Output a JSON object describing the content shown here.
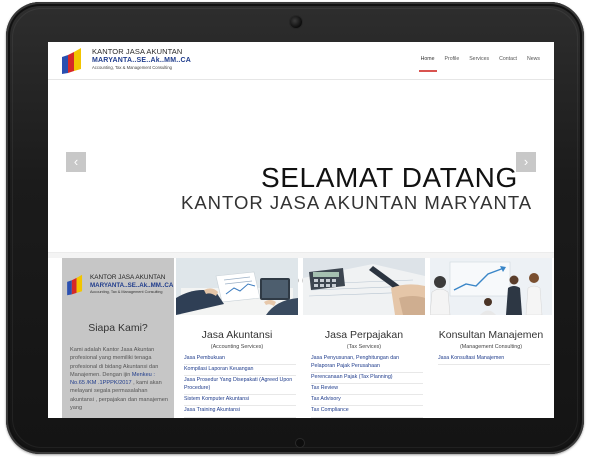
{
  "header": {
    "logo": {
      "line1": "KANTOR JASA AKUNTAN",
      "line2": "MARYANTA..SE..Ak..MM..CA",
      "line3": "Accounting, Tax & Management Consulting"
    },
    "nav": [
      {
        "label": "Home",
        "active": true
      },
      {
        "label": "Profile",
        "active": false
      },
      {
        "label": "Services",
        "active": false
      },
      {
        "label": "Contact",
        "active": false
      },
      {
        "label": "News",
        "active": false
      }
    ]
  },
  "slider": {
    "title": "SELAMAT DATANG",
    "subtitle": "KANTOR JASA AKUNTAN MARYANTA",
    "prev_icon": "chevron-left-icon",
    "next_icon": "chevron-right-icon",
    "prev_glyph": "‹",
    "next_glyph": "›"
  },
  "about": {
    "logo": {
      "line1": "KANTOR JASA AKUNTAN",
      "line2": "MARYANTA..SE..Ak..MM..CA",
      "line3": "Accounting, Tax & Management Consulting"
    },
    "title": "Siapa Kami?",
    "body_part1": "Kami adalah Kantor Jasa Akuntan profesional yang memiliki tenaga profesional di bidang Akuntansi dan Manajemen. Dengan ijin ",
    "body_highlight": "Menkeu : No.65 /KM .1PPPK/2017",
    "body_part2": " , kami akan melayani segala permasalahan akuntansi , perpajakan dan manajemen yang"
  },
  "services": [
    {
      "title": "Jasa Akuntansi",
      "subtitle": "(Accounting Services)",
      "items": [
        "Jasa Pembukuan",
        "Kompilasi Laporan Keuangan",
        "Jasa Prosedur Yang Disepakati (Agreed Upon Procedure)",
        "Sistem Komputer Akuntansi",
        "Jasa Training Akuntansi"
      ]
    },
    {
      "title": "Jasa Perpajakan",
      "subtitle": "(Tax Services)",
      "items": [
        "Jasa Penyusunan, Penghitungan dan Pelaporan Pajak Perusahaan",
        "Perencanaan Pajak (Tax Planning)",
        "Tax Review",
        "Tax Advisory",
        "Tax Compliance"
      ]
    },
    {
      "title": "Konsultan Manajemen",
      "subtitle": "(Management Consulting)",
      "items": [
        "Jasa Konsultasi Manajemen"
      ]
    }
  ],
  "colors": {
    "accent_red": "#d9534f",
    "link_blue": "#1f3c8c",
    "logo_blue": "#2a4fb0",
    "logo_red": "#d62828",
    "logo_yellow": "#f2c500"
  }
}
